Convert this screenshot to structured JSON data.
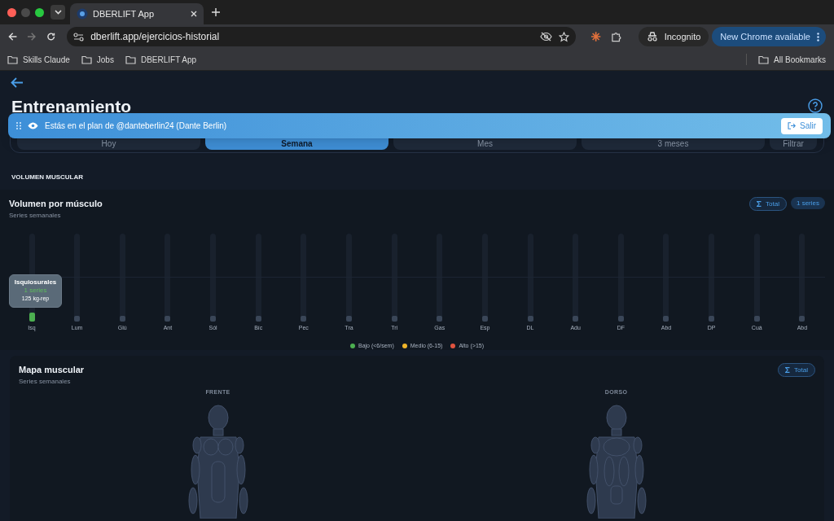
{
  "browser": {
    "tab_title": "DBERLIFT App",
    "url": "dberlift.app/ejercicios-historial",
    "incognito_label": "Incognito",
    "update_button": "New Chrome available",
    "bookmarks": [
      "Skills Claude",
      "Jobs",
      "DBERLIFT App"
    ],
    "all_bookmarks": "All Bookmarks"
  },
  "page": {
    "title": "Entrenamiento",
    "banner": {
      "text": "Estás en el plan de @danteberlin24 (Dante Berlin)",
      "exit_button": "Salir"
    },
    "periods": [
      {
        "label": "Hoy",
        "selected": false
      },
      {
        "label": "Semana",
        "selected": true
      },
      {
        "label": "Mes",
        "selected": false
      },
      {
        "label": "3 meses",
        "selected": false
      }
    ],
    "filter_button": "Filtrar",
    "section_title": "VOLUMEN MUSCULAR",
    "volume_card": {
      "title": "Volumen por músculo",
      "subtitle": "Series semanales",
      "total_badge": "Total",
      "series_badge": "1 series",
      "muscles": [
        {
          "label": "Isq",
          "level": 0.1,
          "color": "#4caf50"
        },
        {
          "label": "Lum",
          "level": 0.06,
          "color": "#3a4658"
        },
        {
          "label": "Glú",
          "level": 0.06,
          "color": "#3a4658"
        },
        {
          "label": "Ant",
          "level": 0.06,
          "color": "#3a4658"
        },
        {
          "label": "Sól",
          "level": 0.06,
          "color": "#3a4658"
        },
        {
          "label": "Bíc",
          "level": 0.06,
          "color": "#3a4658"
        },
        {
          "label": "Pec",
          "level": 0.06,
          "color": "#3a4658"
        },
        {
          "label": "Tra",
          "level": 0.06,
          "color": "#3a4658"
        },
        {
          "label": "Tri",
          "level": 0.06,
          "color": "#3a4658"
        },
        {
          "label": "Gas",
          "level": 0.06,
          "color": "#3a4658"
        },
        {
          "label": "Esp",
          "level": 0.06,
          "color": "#3a4658"
        },
        {
          "label": "DL",
          "level": 0.06,
          "color": "#3a4658"
        },
        {
          "label": "Adu",
          "level": 0.06,
          "color": "#3a4658"
        },
        {
          "label": "DF",
          "level": 0.06,
          "color": "#3a4658"
        },
        {
          "label": "Abd",
          "level": 0.06,
          "color": "#3a4658"
        },
        {
          "label": "DP",
          "level": 0.06,
          "color": "#3a4658"
        },
        {
          "label": "Cuá",
          "level": 0.06,
          "color": "#3a4658"
        },
        {
          "label": "Abd",
          "level": 0.06,
          "color": "#3a4658"
        }
      ],
      "tooltip": {
        "name": "Isquiosurales",
        "series": "1 series",
        "volume": "125 kg-rep"
      },
      "legend": [
        {
          "label": "Bajo (<6/sem)",
          "color": "#4caf50"
        },
        {
          "label": "Medio (6-15)",
          "color": "#f0b429"
        },
        {
          "label": "Alto (>15)",
          "color": "#e0533f"
        }
      ]
    },
    "map_card": {
      "title": "Mapa muscular",
      "subtitle": "Series semanales",
      "total_badge": "Total",
      "views": [
        "FRENTE",
        "DORSO"
      ]
    }
  }
}
